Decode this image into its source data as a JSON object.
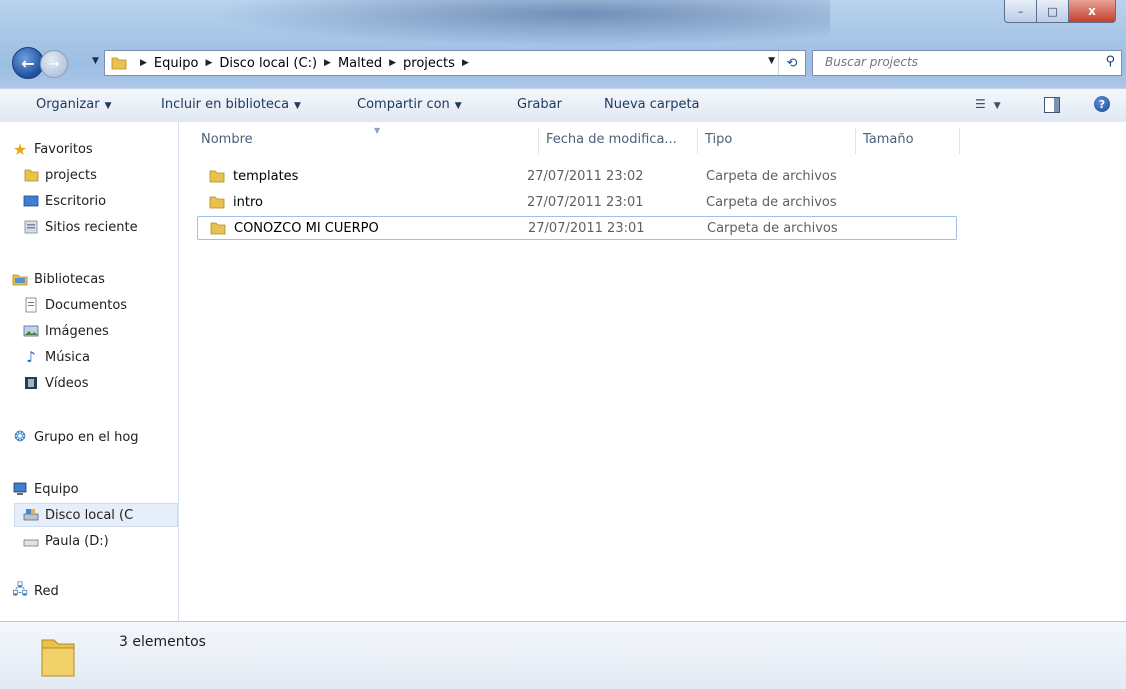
{
  "address": {
    "crumbs": [
      "Equipo",
      "Disco local (C:)",
      "Malted",
      "projects"
    ]
  },
  "search": {
    "placeholder": "Buscar projects"
  },
  "window_controls": {
    "minimize": "–",
    "maximize": "□",
    "close": "x"
  },
  "toolbar": {
    "organize": "Organizar",
    "include": "Incluir en biblioteca",
    "share": "Compartir con",
    "burn": "Grabar",
    "new_folder": "Nueva carpeta",
    "help": "?"
  },
  "nav": {
    "favorites": {
      "label": "Favoritos",
      "items": [
        "projects",
        "Escritorio",
        "Sitios reciente"
      ]
    },
    "libraries": {
      "label": "Bibliotecas",
      "items": [
        "Documentos",
        "Imágenes",
        "Música",
        "Vídeos"
      ]
    },
    "homegroup": {
      "label": "Grupo en el hog"
    },
    "computer": {
      "label": "Equipo",
      "items": [
        "Disco local (C",
        "Paula (D:)"
      ]
    },
    "network": {
      "label": "Red"
    }
  },
  "columns": {
    "name": "Nombre",
    "date": "Fecha de modifica...",
    "type": "Tipo",
    "size": "Tamaño"
  },
  "files": [
    {
      "name": "templates",
      "date": "27/07/2011 23:02",
      "type": "Carpeta de archivos"
    },
    {
      "name": "intro",
      "date": "27/07/2011 23:01",
      "type": "Carpeta de archivos"
    },
    {
      "name": "CONOZCO MI CUERPO",
      "date": "27/07/2011 23:01",
      "type": "Carpeta de archivos"
    }
  ],
  "details": {
    "count": "3 elementos"
  },
  "colors": {
    "accent": "#1e395b",
    "selection": "#9dc1ea",
    "folder": "#e8c24f"
  }
}
